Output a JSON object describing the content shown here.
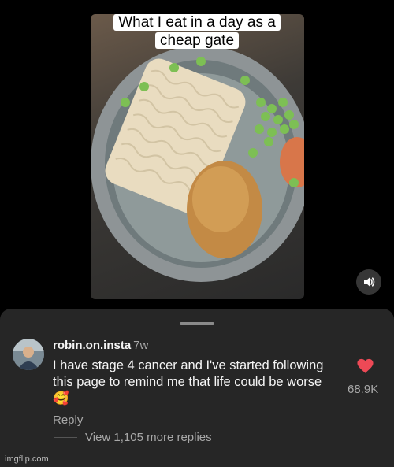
{
  "video": {
    "caption": "What I eat in a day as a cheap gate",
    "volume_icon": "speaker-volume-icon"
  },
  "comment": {
    "username": "robin.on.insta",
    "time": "7w",
    "text": "I have stage 4 cancer and I've started following this page to remind me that life could be worse 🥰",
    "reply_label": "Reply",
    "view_replies_label": "View 1,105 more replies",
    "like_count": "68.9K",
    "like_icon": "heart-icon",
    "like_color": "#ed4956"
  },
  "watermark": "imgflip.com"
}
